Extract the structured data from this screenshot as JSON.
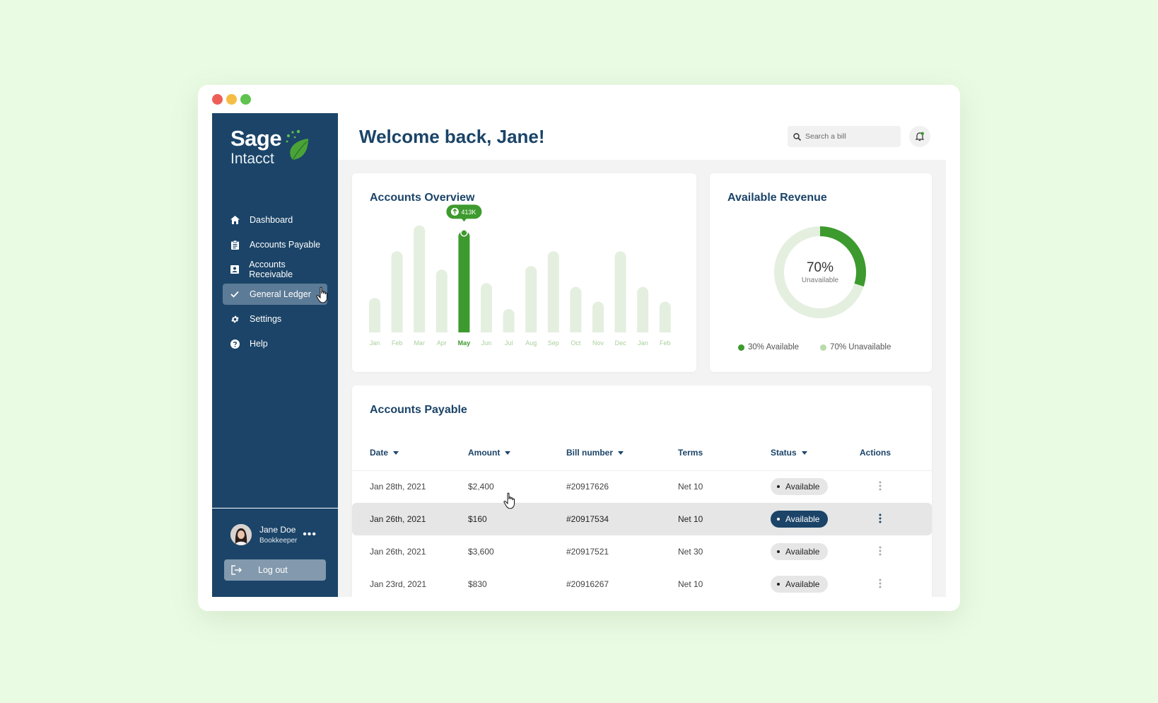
{
  "app": {
    "logo_primary": "Sage",
    "logo_secondary": "Intacct",
    "accent_color": "#3d9a2e",
    "brand_color": "#1b4468"
  },
  "sidebar": {
    "items": [
      {
        "label": "Dashboard",
        "icon": "home-icon"
      },
      {
        "label": "Accounts Payable",
        "icon": "clipboard-icon"
      },
      {
        "label": "Accounts Receivable",
        "icon": "contact-card-icon"
      },
      {
        "label": "General Ledger",
        "icon": "check-icon"
      },
      {
        "label": "Settings",
        "icon": "gear-icon"
      },
      {
        "label": "Help",
        "icon": "help-icon"
      }
    ],
    "user": {
      "name": "Jane Doe",
      "role": "Bookkeeper"
    },
    "logout_label": "Log out"
  },
  "header": {
    "welcome": "Welcome back, Jane!",
    "search_placeholder": "Search a bill"
  },
  "overview": {
    "title": "Accounts Overview",
    "tooltip": "413K"
  },
  "chart_data": [
    {
      "type": "bar",
      "title": "Accounts Overview",
      "categories": [
        "Jan",
        "Feb",
        "Mar",
        "Apr",
        "May",
        "Jun",
        "Jul",
        "Aug",
        "Sep",
        "Oct",
        "Nov",
        "Dec",
        "Jan",
        "Feb"
      ],
      "values": [
        140,
        330,
        435,
        255,
        413,
        200,
        95,
        270,
        330,
        185,
        125,
        330,
        185,
        125
      ],
      "highlighted_category_index": 4,
      "highlighted_label": "413K",
      "ylim": [
        0,
        460
      ],
      "grid": false
    },
    {
      "type": "pie",
      "title": "Available Revenue",
      "center_value": "70%",
      "center_label": "Unavailable",
      "slices": [
        {
          "label": "30% Available",
          "value": 30,
          "color": "#3d9a2e"
        },
        {
          "label": "70% Unavailable",
          "value": 70,
          "color": "#e4efe0"
        }
      ],
      "legend": "bottom"
    }
  ],
  "revenue": {
    "title": "Available Revenue",
    "center_value": "70%",
    "center_label": "Unavailable",
    "legend": [
      "30% Available",
      "70% Unavailable"
    ]
  },
  "payable": {
    "title": "Accounts Payable",
    "columns": [
      "Date",
      "Amount",
      "Bill number",
      "Terms",
      "Status",
      "Actions"
    ],
    "rows": [
      {
        "date": "Jan 28th, 2021",
        "amount": "$2,400",
        "bill": "#20917626",
        "terms": "Net 10",
        "status": "Available"
      },
      {
        "date": "Jan 26th, 2021",
        "amount": "$160",
        "bill": "#20917534",
        "terms": "Net 10",
        "status": "Available"
      },
      {
        "date": "Jan 26th, 2021",
        "amount": "$3,600",
        "bill": "#20917521",
        "terms": "Net 30",
        "status": "Available"
      },
      {
        "date": "Jan 23rd, 2021",
        "amount": "$830",
        "bill": "#20916267",
        "terms": "Net 10",
        "status": "Available"
      }
    ]
  }
}
